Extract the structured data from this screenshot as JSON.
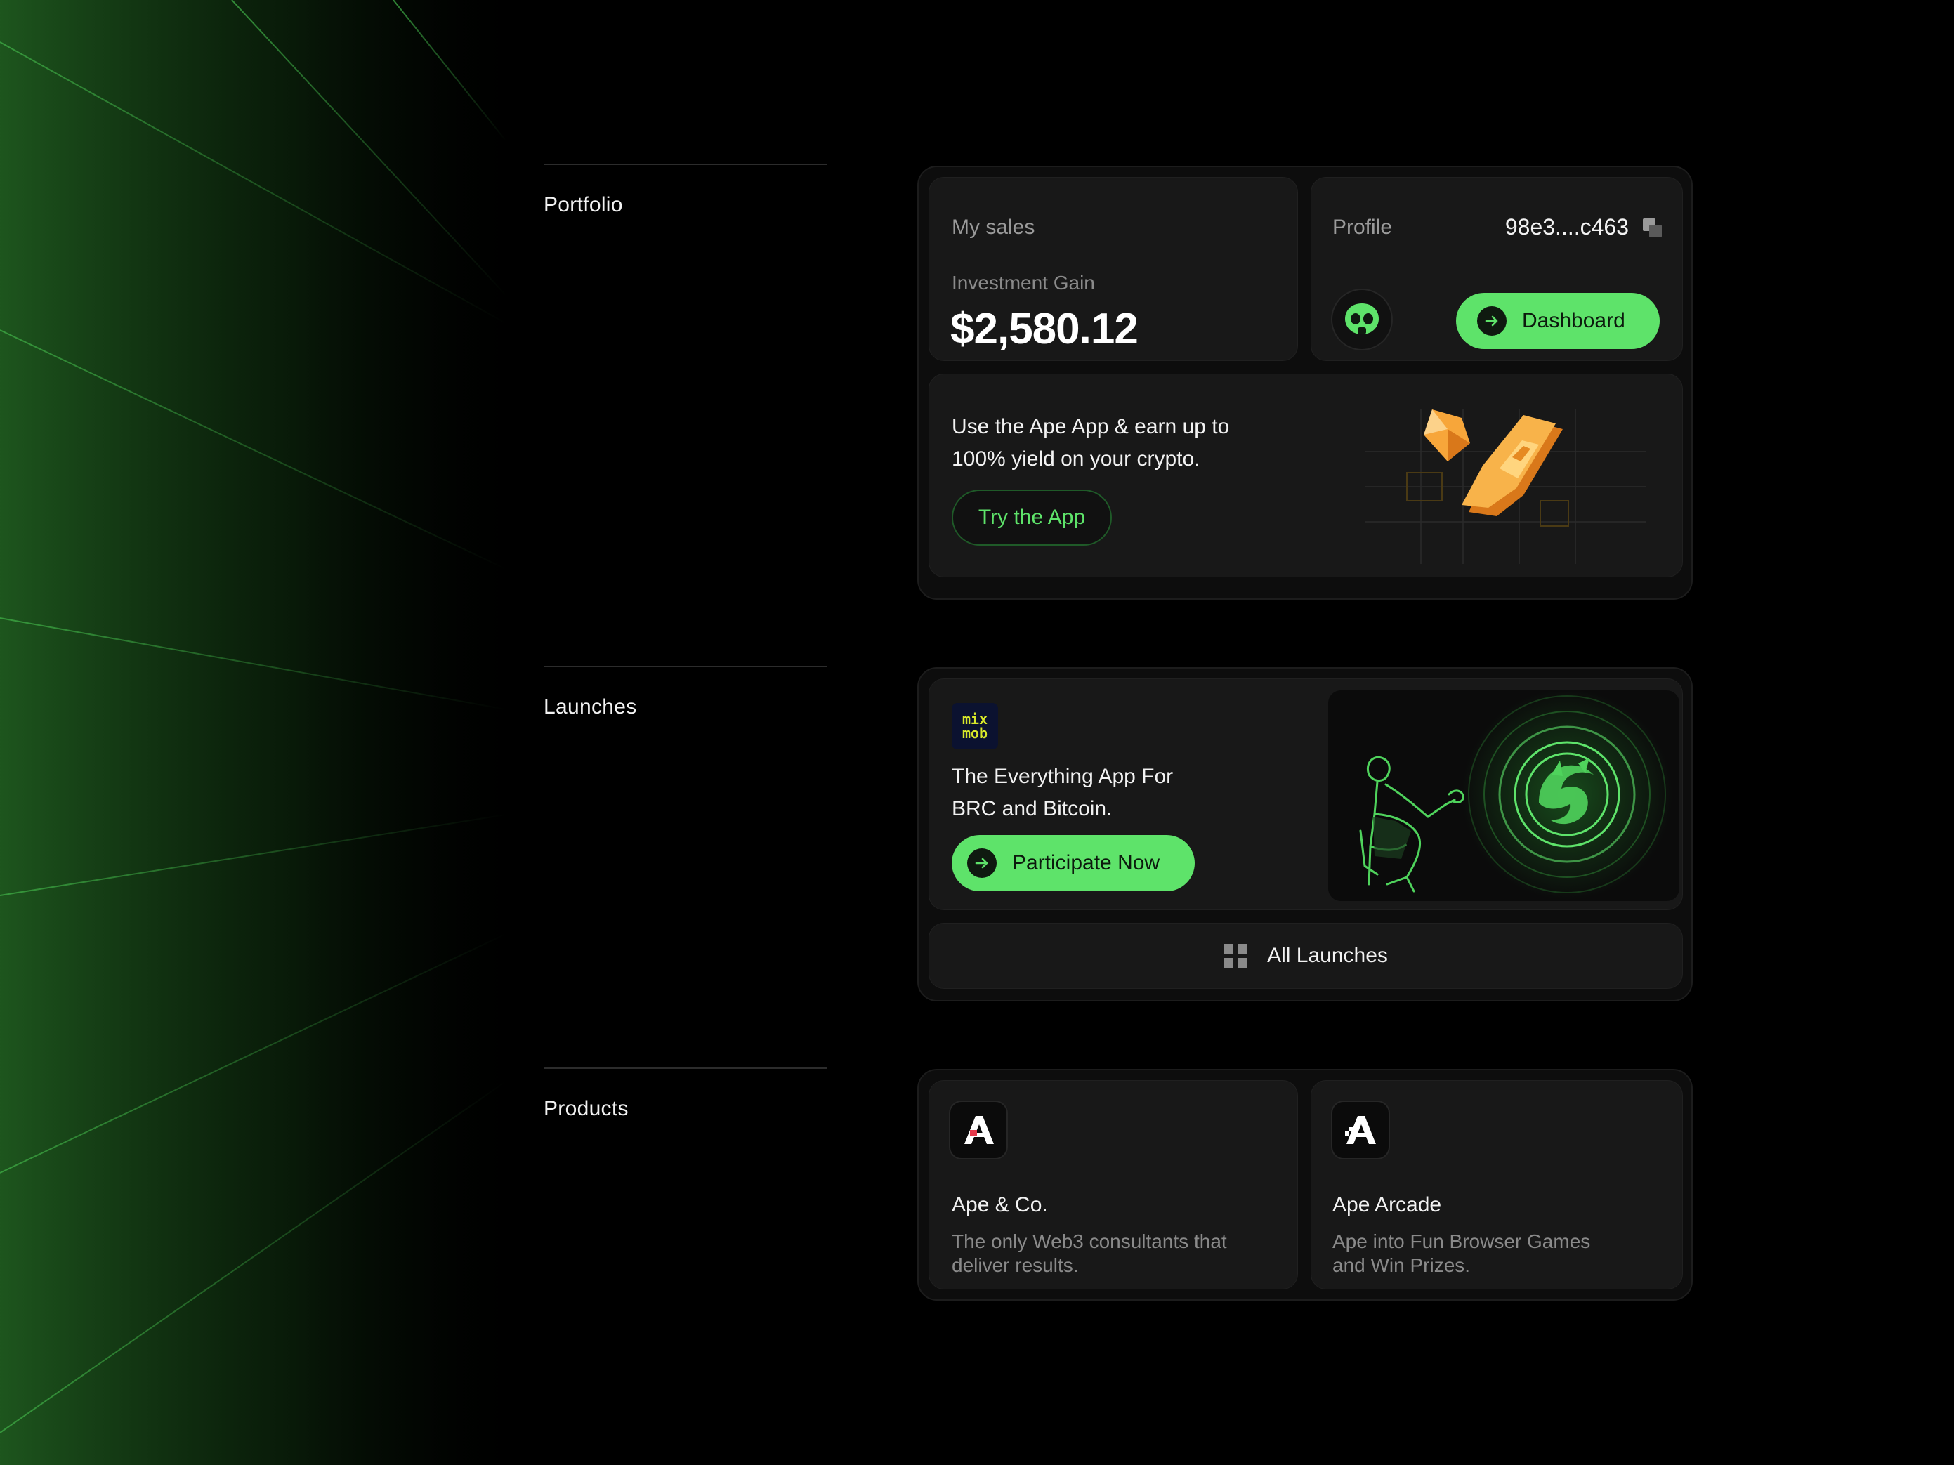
{
  "sections": {
    "portfolio": "Portfolio",
    "launches": "Launches",
    "products": "Products"
  },
  "portfolio": {
    "my_sales_label": "My sales",
    "gain_label": "Investment Gain",
    "gain_value": "$2,580.12",
    "profile_label": "Profile",
    "wallet_address": "98e3....c463",
    "dashboard_button": "Dashboard",
    "promo_line1": "Use the Ape App & earn up to",
    "promo_line2": "100% yield on your crypto.",
    "try_button": "Try the App"
  },
  "launches": {
    "logo_text_1": "mix",
    "logo_text_2": "mob",
    "headline_line1": "The Everything App For",
    "headline_line2": "BRC and Bitcoin.",
    "participate_button": "Participate Now",
    "all_launches_button": "All Launches"
  },
  "products": {
    "items": [
      {
        "title": "Ape & Co.",
        "desc_line1": "The only Web3 consultants that",
        "desc_line2": "deliver results.",
        "icon": "ape-co-logo-icon"
      },
      {
        "title": "Ape Arcade",
        "desc_line1": "Ape into Fun Browser Games",
        "desc_line2": "and Win Prizes.",
        "icon": "ape-arcade-logo-icon"
      }
    ]
  },
  "colors": {
    "accent": "#5EE36A",
    "background": "#000000",
    "card": "#181818",
    "panel": "#0D0D0D",
    "muted_text": "#9A9A9A",
    "gold": "#F5A43A"
  }
}
